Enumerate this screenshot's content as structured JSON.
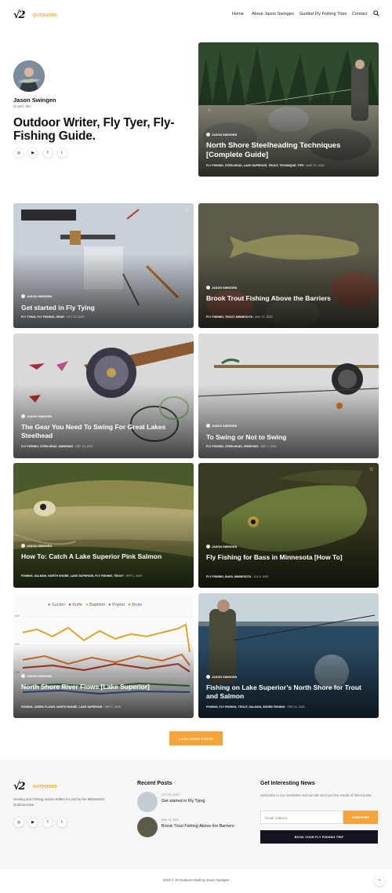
{
  "header": {
    "logo_sub": "OUTDOORS",
    "nav": [
      "Home",
      "About Jason Swingen",
      "Guided Fly Fishing Trips",
      "Contact"
    ]
  },
  "author": {
    "name": "Jason Swingen",
    "location": "Duluth, MN",
    "tagline": "Outdoor Writer, Fly Tyer, Fly-Fishing Guide."
  },
  "social": [
    "instagram-icon",
    "youtube-icon",
    "facebook-icon",
    "twitter-icon"
  ],
  "featured": {
    "author": "JASON SWINGEN",
    "title": "North Shore Steelheading Techniques [Complete Guide]",
    "categories": "FLY FISHING, STEELHEAD, LAKE SUPERIOR, TROUT, TECHNIQUE, TIPS",
    "date": "MAR 22, 2020"
  },
  "posts": [
    {
      "author": "JASON SWINGEN",
      "title": "Get started in Fly Tying",
      "categories": "FLY TYING, FLY FISHING, GEAR",
      "date": "OCT 20, 2020"
    },
    {
      "author": "JASON SWINGEN",
      "title": "Brook Trout Fishing Above the Barriers",
      "categories": "FLY FISHING, TROUT, MINNESOTA",
      "date": "MAY 11, 2020"
    },
    {
      "author": "JASON SWINGEN",
      "title": "The Gear You Need To Swing For Great Lakes Steelhead",
      "categories": "FLY FISHING, STEELHEAD, SWINGING",
      "date": "SEP 10, 2020"
    },
    {
      "author": "JASON SWINGEN",
      "title": "To Swing or Not to Swing",
      "categories": "FLY FISHING, STEELHEAD, SWINGING",
      "date": "SEP 7, 2020"
    },
    {
      "author": "JASON SWINGEN",
      "title": "How To: Catch A Lake Superior Pink Salmon",
      "categories": "FISHING, SALMON, NORTH SHORE, LAKE SUPERIOR, FLY FISHING, TROUT",
      "date": "SEP 1, 2020"
    },
    {
      "author": "JASON SWINGEN",
      "title": "Fly Fishing for Bass in Minnesota [How To]",
      "categories": "FLY FISHING, BASS, MINNESOTA",
      "date": "JUL 8, 2020"
    },
    {
      "author": "JASON SWINGEN",
      "title": "North Shore River Flows [Lake Superior]",
      "categories": "FISHING, CREEK FLOWS, NORTH SHORE, LAKE SUPERIOR",
      "date": "APR 7, 2020"
    },
    {
      "author": "JASON SWINGEN",
      "title": "Fishing on Lake Superior’s North Shore for Trout and Salmon",
      "categories": "FISHING, FLY FISHING, TROUT, SALMON, SHORE FISHING",
      "date": "FEB 24, 2020"
    }
  ],
  "flows_legend": [
    "Sucker",
    "Knife",
    "Baptism",
    "Poplar",
    "Brule"
  ],
  "flows_legend_colors": [
    "#4a78c8",
    "#c23a2a",
    "#e0a52b",
    "#3b8f46",
    "#e07a2a"
  ],
  "flows_ticks": [
    "600",
    "400",
    "200"
  ],
  "load_more": "LOAD MORE POSTS",
  "footer": {
    "about_text": "Hunting and Fishing stories written for and by the Midwestern Outdoorsman.",
    "recent_heading": "Recent Posts",
    "recent": [
      {
        "date": "OCT 20, 2020",
        "title": "Get started in Fly Tying"
      },
      {
        "date": "MAY 11, 2020",
        "title": "Brook Trout Fishing Above the Barriers"
      }
    ],
    "news_heading": "Get Interesting News",
    "news_text": "Subscribe to our newsletter and we will send you the emails of latest posts.",
    "email_placeholder": "Email Address",
    "subscribe": "SUBSCRIBE",
    "book": "BOOK YOUR FLY FISHING TRIP",
    "copyright": "2023 © JS Outdoors Built by Jason Swingen"
  },
  "colors": {
    "accent": "#f5a43a",
    "dark": "#14151f"
  }
}
